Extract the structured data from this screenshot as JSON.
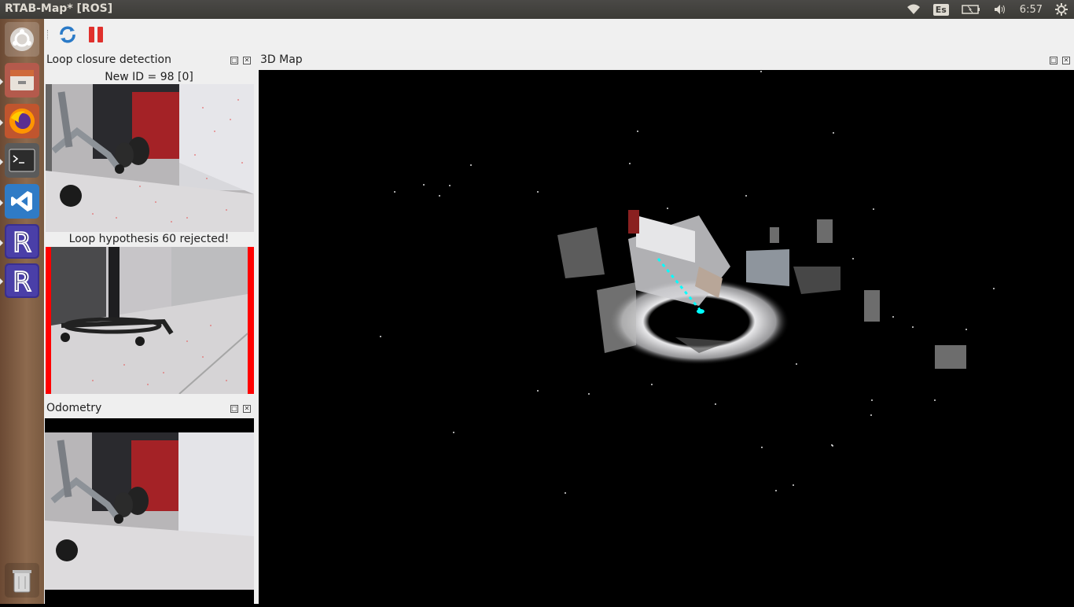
{
  "window": {
    "title": "RTAB-Map* [ROS]"
  },
  "tray": {
    "keyboard_layout": "Es",
    "clock": "6:57",
    "icons": [
      "wifi-icon",
      "keyboard-icon",
      "battery-icon",
      "volume-icon",
      "power-gear-icon"
    ]
  },
  "launcher": {
    "items": [
      {
        "name": "ubuntu-dash-icon"
      },
      {
        "name": "file-manager-icon"
      },
      {
        "name": "firefox-icon"
      },
      {
        "name": "terminal-icon"
      },
      {
        "name": "vscode-icon"
      },
      {
        "name": "rtabmap-icon",
        "letter": "R"
      },
      {
        "name": "rtabmap-icon-2",
        "letter": "R"
      },
      {
        "name": "trash-icon"
      }
    ]
  },
  "toolbar": {
    "refresh_icon": "refresh-icon",
    "pause_icon": "pause-icon"
  },
  "loop_panel": {
    "title": "Loop closure detection",
    "new_id_caption": "New ID = 98 [0]",
    "hypothesis_caption": "Loop hypothesis 60 rejected!",
    "rejected_color": "#ff0000"
  },
  "odometry_panel": {
    "title": "Odometry"
  },
  "map_panel": {
    "title": "3D Map",
    "path_color": "#00ffff"
  }
}
